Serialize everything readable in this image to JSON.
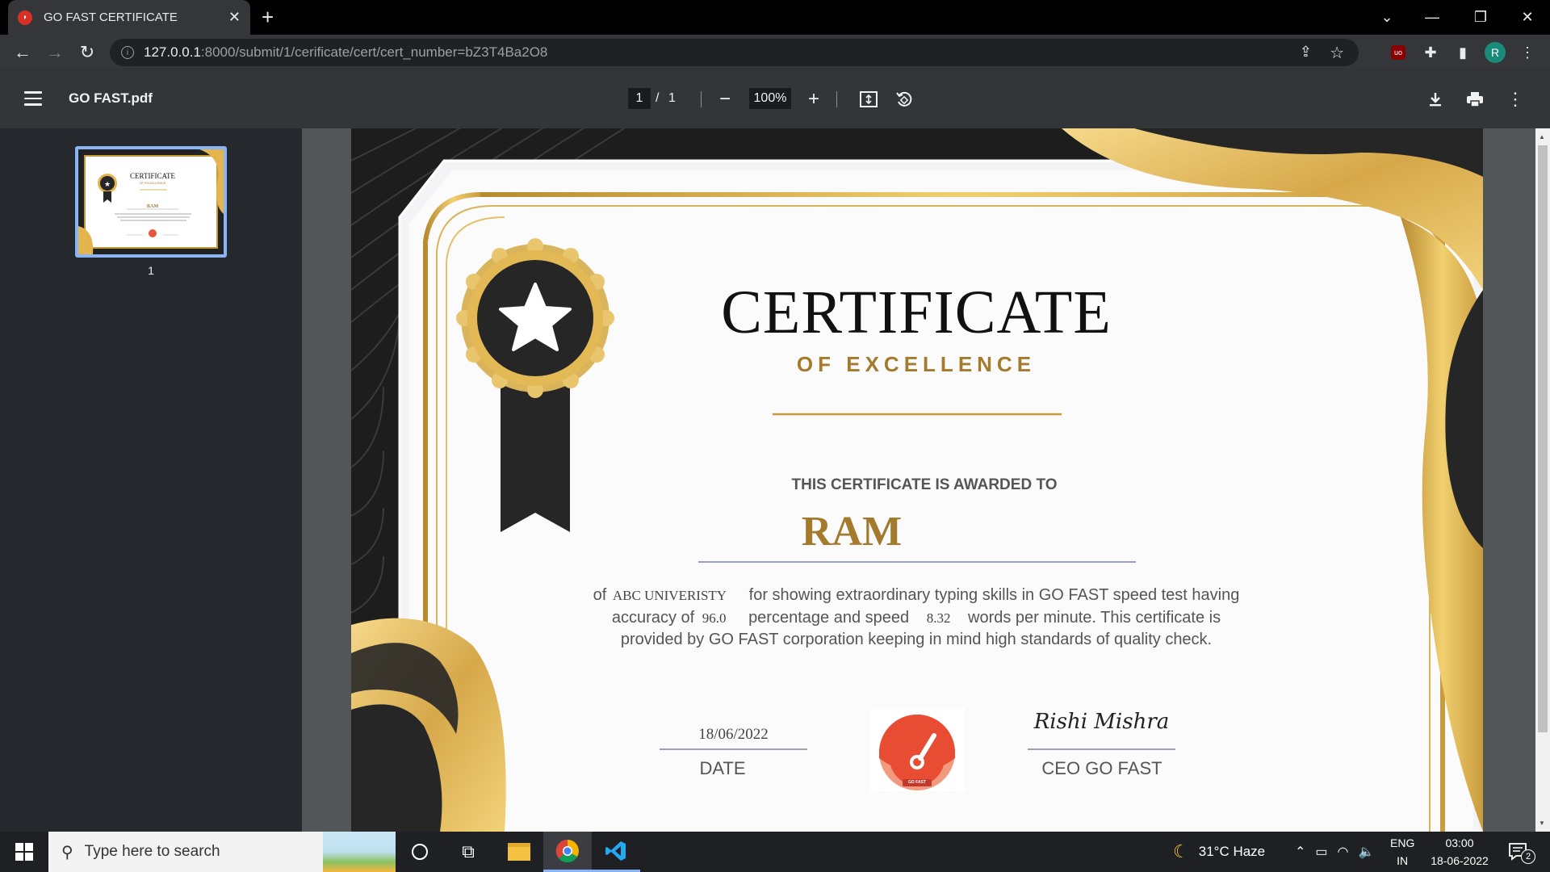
{
  "browser": {
    "tab_title": "GO FAST CERTIFICATE",
    "url_host": "127.0.0.1",
    "url_path": ":8000/submit/1/cerificate/cert/cert_number=bZ3T4Ba2O8",
    "profile_initial": "R",
    "extension_badge": "uo"
  },
  "pdf": {
    "filename": "GO FAST.pdf",
    "current_page": "1",
    "page_separator": "/",
    "total_pages": "1",
    "zoom": "100%",
    "thumbnail_label": "1"
  },
  "certificate": {
    "title": "CERTIFICATE",
    "subtitle": "OF EXCELLENCE",
    "awarded_line": "THIS CERTIFICATE IS AWARDED TO",
    "recipient": "RAM",
    "body_of": "of",
    "university": "ABC UNIVERISTY",
    "body_1": "for showing extraordinary typing skills in GO FAST speed test having",
    "body_accuracy": "accuracy of",
    "accuracy": "96.0",
    "body_speed": "percentage and speed",
    "speed": "8.32",
    "body_2": "words per minute. This certificate is",
    "body_3": "provided by GO FAST corporation keeping in mind high standards of quality check.",
    "date_value": "18/06/2022",
    "date_label": "DATE",
    "signature": "Rishi Mishra",
    "signer_title": "CEO GO FAST",
    "logo_text": "GO FAST",
    "thumb_title": "CERTIFICATE",
    "thumb_subtitle": "OF EXCELLENCE",
    "thumb_recipient": "RAM"
  },
  "taskbar": {
    "search_placeholder": "Type here to search",
    "weather": "31°C  Haze",
    "lang_1": "ENG",
    "lang_2": "IN",
    "time": "03:00",
    "date": "18-06-2022",
    "notification_count": "2"
  },
  "colors": {
    "gold": "#c49a3a",
    "gold_light": "#f3d27a",
    "dark": "#262626",
    "title_gold": "#a47a2c"
  }
}
